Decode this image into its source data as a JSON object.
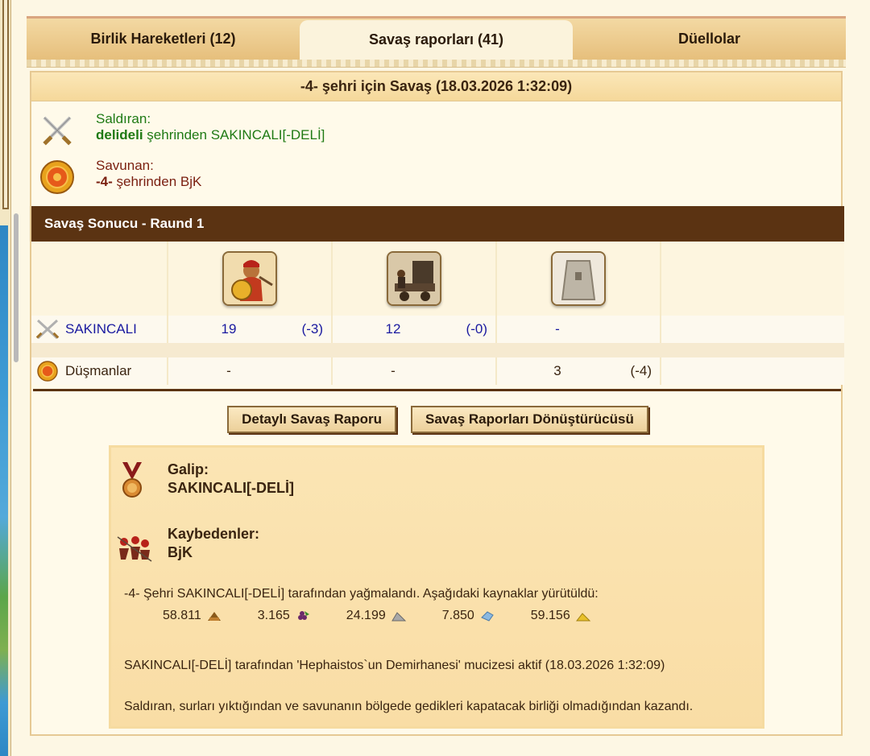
{
  "tabs": [
    {
      "label": "Birlik Hareketleri (12)"
    },
    {
      "label": "Savaş raporları (41)"
    },
    {
      "label": "Düellolar"
    }
  ],
  "report": {
    "title": "-4- şehri için Savaş (18.03.2026 1:32:09)",
    "attacker": {
      "role": "Saldıran:",
      "city": "delideli",
      "suffix": " şehrinden SAKINCALI[-DELİ]"
    },
    "defender": {
      "role": "Savunan:",
      "city": "-4-",
      "suffix": " şehrinden BjK"
    }
  },
  "result_header": "Savaş Sonucu - Raund 1",
  "units": {
    "attacker_row": {
      "name": "SAKINCALI",
      "cells": [
        {
          "value": "19",
          "loss": "(-3)"
        },
        {
          "value": "12",
          "loss": "(-0)"
        },
        {
          "value": "-",
          "loss": ""
        }
      ]
    },
    "enemy_row": {
      "name": "Düşmanlar",
      "cells": [
        {
          "value": "-",
          "loss": ""
        },
        {
          "value": "-",
          "loss": ""
        },
        {
          "value": "3",
          "loss": "(-4)"
        }
      ]
    }
  },
  "buttons": {
    "detailed": "Detaylı Savaş Raporu",
    "converter": "Savaş Raporları Dönüştürücüsü"
  },
  "summary": {
    "winner_label": "Galip:",
    "winner_name": "SAKINCALI[-DELİ]",
    "losers_label": "Kaybedenler:",
    "losers_name": "BjK",
    "plunder_text": "-4- Şehri SAKINCALI[-DELİ] tarafından yağmalandı. Aşağıdaki kaynaklar yürütüldü:",
    "resources": [
      {
        "amount": "58.811",
        "icon": "wood-icon"
      },
      {
        "amount": "3.165",
        "icon": "wine-icon"
      },
      {
        "amount": "24.199",
        "icon": "marble-icon"
      },
      {
        "amount": "7.850",
        "icon": "crystal-icon"
      },
      {
        "amount": "59.156",
        "icon": "sulfur-icon"
      }
    ],
    "wonder_text": "SAKINCALI[-DELİ] tarafından 'Hephaistos`un Demirhanesi' mucizesi aktif (18.03.2026 1:32:09)",
    "reason_text": "Saldıran, surları yıktığından ve savunanın bölgede gedikleri kapatacak birliği olmadığından kazandı."
  },
  "colors": {
    "header_bg": "#5b3312",
    "attacker_text": "#1f7a14",
    "defender_text": "#7a1f10",
    "link_blue": "#1a1aa0"
  }
}
